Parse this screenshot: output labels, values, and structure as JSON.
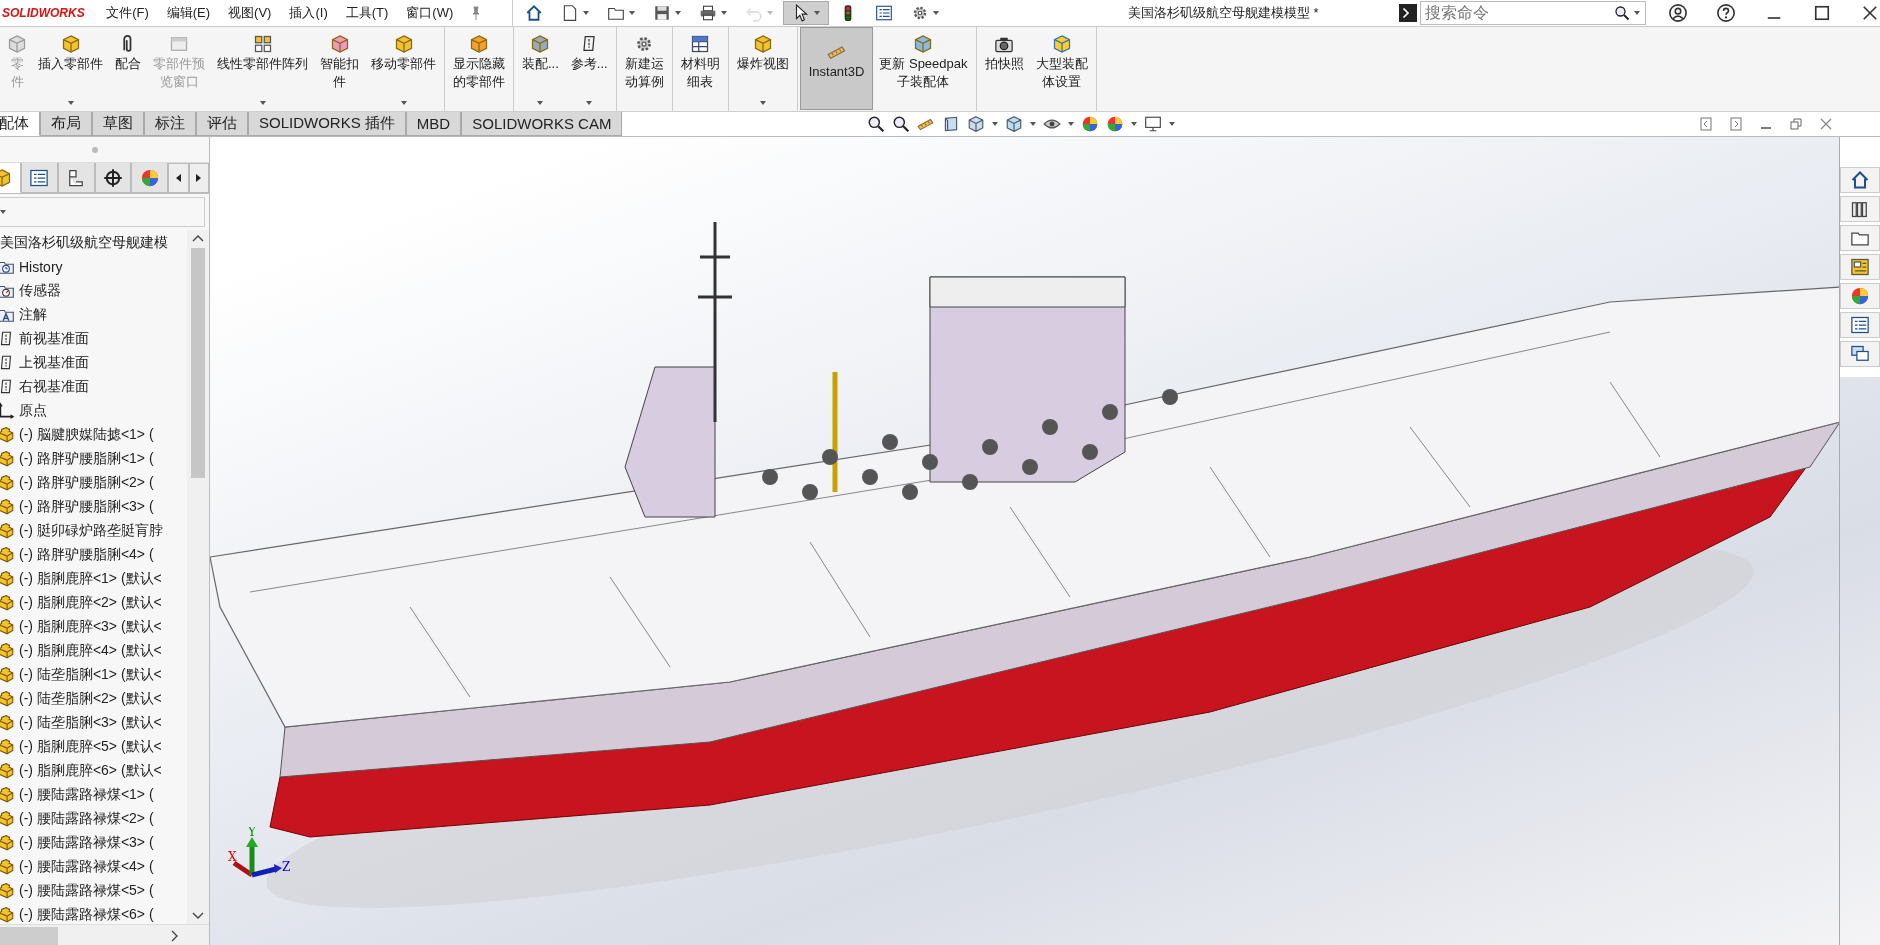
{
  "app": {
    "logo": "SOLIDWORKS",
    "menus": [
      "文件(F)",
      "编辑(E)",
      "视图(V)",
      "插入(I)",
      "工具(T)",
      "窗口(W)"
    ],
    "quick_access": [
      {
        "disabled": false,
        "selected": false
      },
      {
        "disabled": false,
        "selected": false
      },
      {
        "disabled": false,
        "selected": false
      },
      {
        "disabled": false,
        "selected": false
      },
      {
        "disabled": false,
        "selected": false
      },
      {
        "disabled": true,
        "selected": false
      },
      {
        "disabled": false,
        "selected": true
      },
      {
        "disabled": false,
        "selected": false
      },
      {
        "disabled": false,
        "selected": false
      },
      {
        "disabled": false,
        "selected": false
      }
    ],
    "title": "美国洛杉矶级航空母舰建模模型 *",
    "search": {
      "placeholder": "搜索命令"
    }
  },
  "command_manager": {
    "groups": [
      {
        "buttons": [
          {
            "lines": [
              "零",
              "件"
            ],
            "disabled": true,
            "dropdown": false
          },
          {
            "lines": [
              "插入零部件"
            ],
            "disabled": false,
            "dropdown": true
          },
          {
            "lines": [
              "配合"
            ],
            "disabled": false,
            "dropdown": false
          },
          {
            "lines": [
              "零部件预",
              "览窗口"
            ],
            "disabled": true,
            "dropdown": false
          },
          {
            "lines": [
              "线性零部件阵列"
            ],
            "disabled": false,
            "dropdown": true
          },
          {
            "lines": [
              "智能扣",
              "件"
            ],
            "disabled": false,
            "dropdown": false
          },
          {
            "lines": [
              "移动零部件"
            ],
            "disabled": false,
            "dropdown": true
          }
        ]
      },
      {
        "buttons": [
          {
            "lines": [
              "显示隐藏",
              "的零部件"
            ],
            "disabled": false,
            "dropdown": false
          }
        ]
      },
      {
        "buttons": [
          {
            "lines": [
              "装配..."
            ],
            "disabled": false,
            "dropdown": true
          },
          {
            "lines": [
              "参考..."
            ],
            "disabled": false,
            "dropdown": true
          }
        ]
      },
      {
        "buttons": [
          {
            "lines": [
              "新建运",
              "动算例"
            ],
            "disabled": false,
            "dropdown": false
          }
        ]
      },
      {
        "buttons": [
          {
            "lines": [
              "材料明",
              "细表"
            ],
            "disabled": false,
            "dropdown": false
          }
        ]
      },
      {
        "buttons": [
          {
            "lines": [
              "爆炸视图"
            ],
            "disabled": false,
            "dropdown": true
          }
        ]
      },
      {
        "buttons": [
          {
            "lines": [
              "Instant3D"
            ],
            "disabled": false,
            "dropdown": false,
            "selected": true
          },
          {
            "lines": [
              "更新 Speedpak",
              "子装配体"
            ],
            "disabled": false,
            "dropdown": false,
            "selected": false
          }
        ]
      },
      {
        "buttons": [
          {
            "lines": [
              "拍快照"
            ],
            "disabled": false,
            "dropdown": false
          },
          {
            "lines": [
              "大型装配",
              "体设置"
            ],
            "disabled": false,
            "dropdown": false
          }
        ]
      }
    ]
  },
  "tabs": [
    {
      "label": "配体",
      "selected": true
    },
    {
      "label": "布局",
      "selected": false
    },
    {
      "label": "草图",
      "selected": false
    },
    {
      "label": "标注",
      "selected": false
    },
    {
      "label": "评估",
      "selected": false
    },
    {
      "label": "SOLIDWORKS 插件",
      "selected": false
    },
    {
      "label": "MBD",
      "selected": false
    },
    {
      "label": "SOLIDWORKS CAM",
      "selected": false
    }
  ],
  "feature_manager": {
    "tabs": [
      {
        "selected": true
      },
      {
        "selected": false
      },
      {
        "selected": false
      },
      {
        "selected": false
      },
      {
        "selected": false
      }
    ],
    "tree": {
      "label": "美国洛杉矶级航空母舰建模",
      "children": [
        {
          "kind": "history",
          "label": "History"
        },
        {
          "kind": "sensors",
          "label": "传感器"
        },
        {
          "kind": "annotations",
          "label": "注解"
        },
        {
          "kind": "plane",
          "label": "前视基准面"
        },
        {
          "kind": "plane",
          "label": "上视基准面"
        },
        {
          "kind": "plane",
          "label": "右视基准面"
        },
        {
          "kind": "origin",
          "label": "原点"
        },
        {
          "kind": "part",
          "label": "(-) 脳腱腴媒陆摅<1> ("
        },
        {
          "kind": "part",
          "label": "(-) 路胖驴腰脂脷<1> ("
        },
        {
          "kind": "part",
          "label": "(-) 路胖驴腰脂脷<2> ("
        },
        {
          "kind": "part",
          "label": "(-) 路胖驴腰脂脷<3> ("
        },
        {
          "kind": "part",
          "label": "(-) 脡卯碌炉路垄脡肓脖"
        },
        {
          "kind": "part",
          "label": "(-) 路胖驴腰脂脷<4> ("
        },
        {
          "kind": "part",
          "label": "(-) 脂脷鹿脺<1> (默认<"
        },
        {
          "kind": "part",
          "label": "(-) 脂脷鹿脺<2> (默认<"
        },
        {
          "kind": "part",
          "label": "(-) 脂脷鹿脺<3> (默认<"
        },
        {
          "kind": "part",
          "label": "(-) 脂脷鹿脺<4> (默认<"
        },
        {
          "kind": "part",
          "label": "(-) 陆垄脂脷<1> (默认<"
        },
        {
          "kind": "part",
          "label": "(-) 陆垄脂脷<2> (默认<"
        },
        {
          "kind": "part",
          "label": "(-) 陆垄脂脷<3> (默认<"
        },
        {
          "kind": "part",
          "label": "(-) 脂脷鹿脺<5> (默认<"
        },
        {
          "kind": "part",
          "label": "(-) 脂脷鹿脺<6> (默认<"
        },
        {
          "kind": "part",
          "label": "(-) 腰陆露路禄煤<1> ("
        },
        {
          "kind": "part",
          "label": "(-) 腰陆露路禄煤<2> ("
        },
        {
          "kind": "part",
          "label": "(-) 腰陆露路禄煤<3> ("
        },
        {
          "kind": "part",
          "label": "(-) 腰陆露路禄煤<4> ("
        },
        {
          "kind": "part",
          "label": "(-) 腰陆露路禄煤<5> ("
        },
        {
          "kind": "part",
          "label": "(-) 腰陆露路禄煤<6> ("
        }
      ]
    }
  },
  "viewport": {
    "triad": {
      "x": "X",
      "y": "Y",
      "z": "Z"
    }
  }
}
